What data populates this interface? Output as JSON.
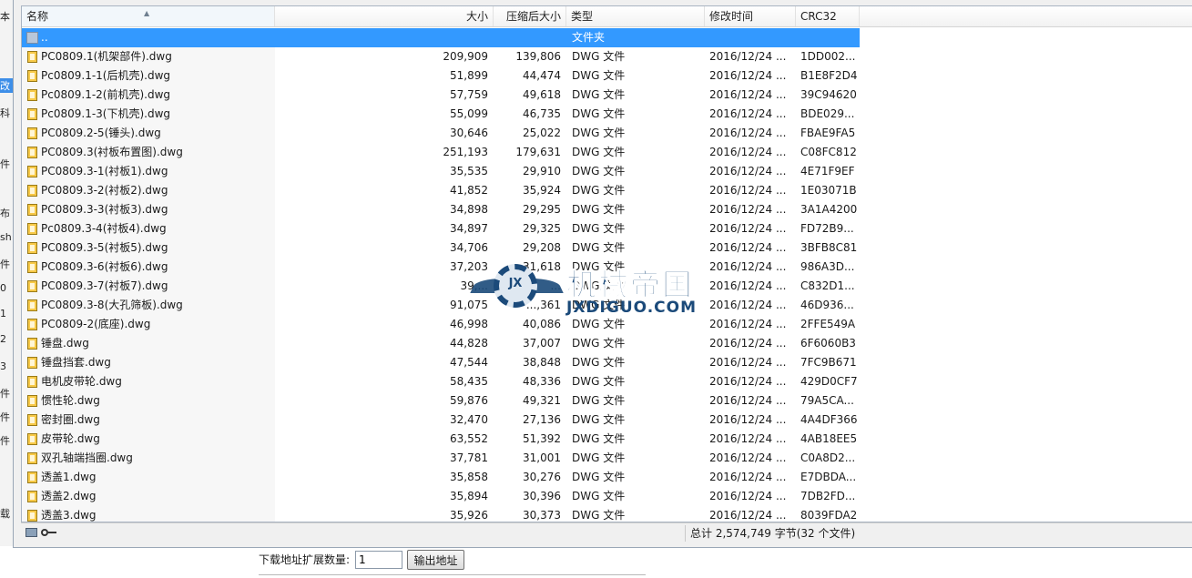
{
  "left_strip": [
    "本",
    "改",
    "科",
    "件",
    "布",
    "sh",
    "件",
    "0",
    "1",
    "2",
    "3",
    "件",
    "件",
    "件",
    "载"
  ],
  "columns": {
    "name": "名称",
    "size": "大小",
    "compressed": "压缩后大小",
    "type": "类型",
    "modified": "修改时间",
    "crc": "CRC32"
  },
  "folder_row": {
    "name": "..",
    "type": "文件夹"
  },
  "files": [
    {
      "name": "PC0809.1(机架部件).dwg",
      "size": "209,909",
      "compressed": "139,806",
      "type": "DWG 文件",
      "modified": "2016/12/24 ...",
      "crc": "1DD002..."
    },
    {
      "name": "Pc0809.1-1(后机壳).dwg",
      "size": "51,899",
      "compressed": "44,474",
      "type": "DWG 文件",
      "modified": "2016/12/24 ...",
      "crc": "B1E8F2D4"
    },
    {
      "name": "Pc0809.1-2(前机壳).dwg",
      "size": "57,759",
      "compressed": "49,618",
      "type": "DWG 文件",
      "modified": "2016/12/24 ...",
      "crc": "39C94620"
    },
    {
      "name": "Pc0809.1-3(下机壳).dwg",
      "size": "55,099",
      "compressed": "46,735",
      "type": "DWG 文件",
      "modified": "2016/12/24 ...",
      "crc": "BDE029..."
    },
    {
      "name": "PC0809.2-5(锤头).dwg",
      "size": "30,646",
      "compressed": "25,022",
      "type": "DWG 文件",
      "modified": "2016/12/24 ...",
      "crc": "FBAE9FA5"
    },
    {
      "name": "PC0809.3(衬板布置图).dwg",
      "size": "251,193",
      "compressed": "179,631",
      "type": "DWG 文件",
      "modified": "2016/12/24 ...",
      "crc": "C08FC812"
    },
    {
      "name": "PC0809.3-1(衬板1).dwg",
      "size": "35,535",
      "compressed": "29,910",
      "type": "DWG 文件",
      "modified": "2016/12/24 ...",
      "crc": "4E71F9EF"
    },
    {
      "name": "PC0809.3-2(衬板2).dwg",
      "size": "41,852",
      "compressed": "35,924",
      "type": "DWG 文件",
      "modified": "2016/12/24 ...",
      "crc": "1E03071B"
    },
    {
      "name": "PC0809.3-3(衬板3).dwg",
      "size": "34,898",
      "compressed": "29,295",
      "type": "DWG 文件",
      "modified": "2016/12/24 ...",
      "crc": "3A1A4200"
    },
    {
      "name": "Pc0809.3-4(衬板4).dwg",
      "size": "34,897",
      "compressed": "29,325",
      "type": "DWG 文件",
      "modified": "2016/12/24 ...",
      "crc": "FD72B9..."
    },
    {
      "name": "PC0809.3-5(衬板5).dwg",
      "size": "34,706",
      "compressed": "29,208",
      "type": "DWG 文件",
      "modified": "2016/12/24 ...",
      "crc": "3BFB8C81"
    },
    {
      "name": "PC0809.3-6(衬板6).dwg",
      "size": "37,203",
      "compressed": "31,618",
      "type": "DWG 文件",
      "modified": "2016/12/24 ...",
      "crc": "986A3D..."
    },
    {
      "name": "PC0809.3-7(衬板7).dwg",
      "size": "39,...",
      "compressed": "...",
      "type": "DWG 文件",
      "modified": "2016/12/24 ...",
      "crc": "C832D1..."
    },
    {
      "name": "PC0809.3-8(大孔筛板).dwg",
      "size": "91,075",
      "compressed": "...,361",
      "type": "DWG 文件",
      "modified": "2016/12/24 ...",
      "crc": "46D936..."
    },
    {
      "name": "PC0809-2(底座).dwg",
      "size": "46,998",
      "compressed": "40,086",
      "type": "DWG 文件",
      "modified": "2016/12/24 ...",
      "crc": "2FFE549A"
    },
    {
      "name": "锤盘.dwg",
      "size": "44,828",
      "compressed": "37,007",
      "type": "DWG 文件",
      "modified": "2016/12/24 ...",
      "crc": "6F6060B3"
    },
    {
      "name": "锤盘挡套.dwg",
      "size": "47,544",
      "compressed": "38,848",
      "type": "DWG 文件",
      "modified": "2016/12/24 ...",
      "crc": "7FC9B671"
    },
    {
      "name": "电机皮带轮.dwg",
      "size": "58,435",
      "compressed": "48,336",
      "type": "DWG 文件",
      "modified": "2016/12/24 ...",
      "crc": "429D0CF7"
    },
    {
      "name": "惯性轮.dwg",
      "size": "59,876",
      "compressed": "49,321",
      "type": "DWG 文件",
      "modified": "2016/12/24 ...",
      "crc": "79A5CA..."
    },
    {
      "name": "密封圈.dwg",
      "size": "32,470",
      "compressed": "27,136",
      "type": "DWG 文件",
      "modified": "2016/12/24 ...",
      "crc": "4A4DF366"
    },
    {
      "name": "皮带轮.dwg",
      "size": "63,552",
      "compressed": "51,392",
      "type": "DWG 文件",
      "modified": "2016/12/24 ...",
      "crc": "4AB18EE5"
    },
    {
      "name": "双孔轴端挡圈.dwg",
      "size": "37,781",
      "compressed": "31,001",
      "type": "DWG 文件",
      "modified": "2016/12/24 ...",
      "crc": "C0A8D2..."
    },
    {
      "name": "透盖1.dwg",
      "size": "35,858",
      "compressed": "30,276",
      "type": "DWG 文件",
      "modified": "2016/12/24 ...",
      "crc": "E7DBDA..."
    },
    {
      "name": "透盖2.dwg",
      "size": "35,894",
      "compressed": "30,396",
      "type": "DWG 文件",
      "modified": "2016/12/24 ...",
      "crc": "7DB2FD..."
    },
    {
      "name": "透盖3.dwg",
      "size": "35,926",
      "compressed": "30,373",
      "type": "DWG 文件",
      "modified": "2016/12/24 ...",
      "crc": "8039FDA2"
    }
  ],
  "status": {
    "summary": "总计 2,574,749 字节(32 个文件)"
  },
  "bottom": {
    "label": "下载地址扩展数量:",
    "input_value": "1",
    "button_label": "输出地址"
  },
  "watermark": {
    "gear_text": "JX",
    "cn": "机械帝国",
    "en": "JXDIGUO.COM"
  },
  "colors": {
    "selection": "#3399ff",
    "dwg_icon": "#f7c948",
    "watermark": "#1b4a7a"
  }
}
